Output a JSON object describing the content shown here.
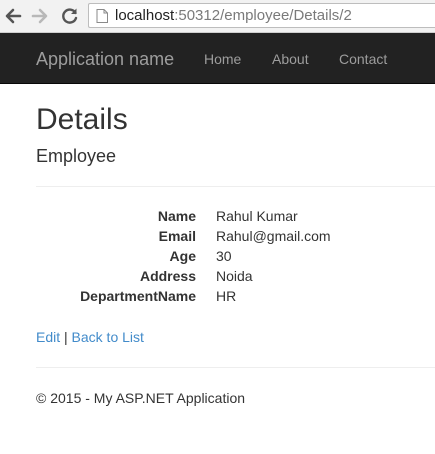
{
  "browser": {
    "url_host": "localhost",
    "url_path": ":50312/employee/Details/2"
  },
  "navbar": {
    "brand": "Application name",
    "links": [
      "Home",
      "About",
      "Contact"
    ]
  },
  "page": {
    "title": "Details",
    "subtitle": "Employee"
  },
  "details": [
    {
      "label": "Name",
      "value": "Rahul Kumar"
    },
    {
      "label": "Email",
      "value": "Rahul@gmail.com"
    },
    {
      "label": "Age",
      "value": "30"
    },
    {
      "label": "Address",
      "value": "Noida"
    },
    {
      "label": "DepartmentName",
      "value": "HR"
    }
  ],
  "actions": {
    "edit": "Edit",
    "separator": "|",
    "back": "Back to List"
  },
  "footer": {
    "text": "© 2015 - My ASP.NET Application"
  },
  "colors": {
    "navbar_bg": "#222222",
    "navbar_text": "#9d9d9d",
    "link": "#428bca"
  }
}
